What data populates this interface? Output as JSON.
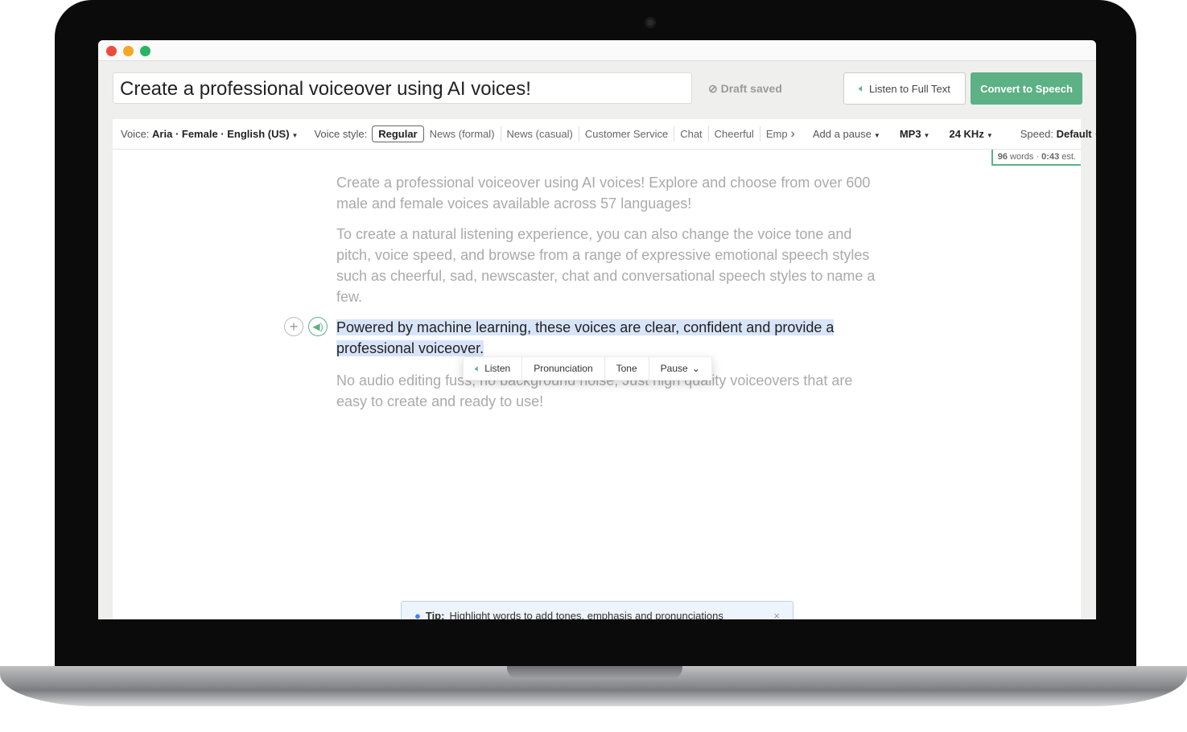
{
  "header": {
    "title": "Create a professional voiceover using AI voices!",
    "draft_status": "Draft saved",
    "listen_full": "Listen to Full Text",
    "convert": "Convert to Speech"
  },
  "toolbar": {
    "voice_label": "Voice:",
    "voice_value": "Aria · Female · English (US)",
    "style_label": "Voice style:",
    "styles": [
      "Regular",
      "News (formal)",
      "News (casual)",
      "Customer Service",
      "Chat",
      "Cheerful",
      "Emp"
    ],
    "add_pause": "Add a pause",
    "format": "MP3",
    "rate": "24 KHz",
    "speed_label": "Speed:",
    "speed_value": "Default"
  },
  "stats": {
    "words": "96",
    "words_label": "words",
    "duration": "0:43",
    "duration_label": "est."
  },
  "editor": {
    "paragraphs": [
      "Create a professional voiceover using AI voices! Explore and choose from over 600 male and female voices available across 57 languages!",
      "To create a natural listening experience, you can also change the voice tone and pitch, voice speed, and browse from a range of expressive emotional speech styles such as cheerful, sad, newscaster, chat and conversational speech styles to name a few.",
      "Powered by machine learning, these voices are clear, confident and provide a professional voiceover.",
      "No audio editing fuss, no background noise, Just high quality voiceovers that are easy to create and ready to use!"
    ]
  },
  "popup": {
    "listen": "Listen",
    "pronunciation": "Pronunciation",
    "tone": "Tone",
    "pause": "Pause"
  },
  "tip": {
    "label": "Tip:",
    "text": "Highlight words to add tones, emphasis and pronunciations"
  },
  "colors": {
    "accent": "#5cb185",
    "highlight": "#d8e4f8"
  }
}
